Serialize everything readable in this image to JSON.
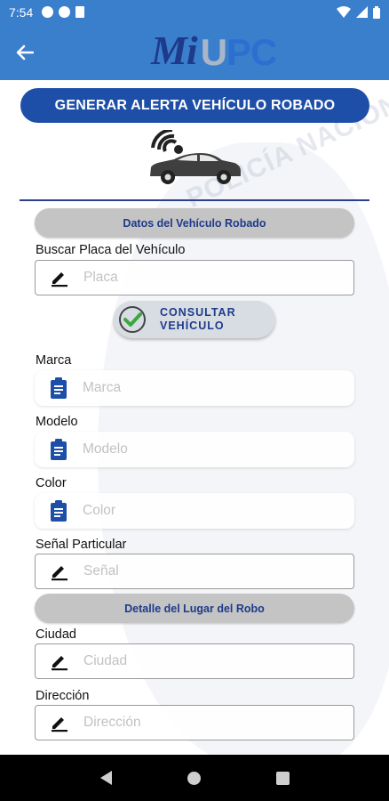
{
  "status_bar": {
    "time": "7:54"
  },
  "app_bar": {
    "logo_mi": "Mi",
    "logo_u": "U",
    "logo_pc": "PC"
  },
  "title_button": "GENERAR ALERTA VEHÍCULO ROBADO",
  "watermark": "POLICÍA NACIONAL",
  "sections": {
    "vehicle": "Datos del Vehículo Robado",
    "location": "Detalle del Lugar del Robo"
  },
  "fields": {
    "placa": {
      "label": "Buscar Placa del Vehículo",
      "placeholder": "Placa"
    },
    "marca": {
      "label": "Marca",
      "placeholder": "Marca"
    },
    "modelo": {
      "label": "Modelo",
      "placeholder": "Modelo"
    },
    "color": {
      "label": "Color",
      "placeholder": "Color"
    },
    "senal": {
      "label": "Señal Particular",
      "placeholder": "Señal"
    },
    "ciudad": {
      "label": "Ciudad",
      "placeholder": "Ciudad"
    },
    "direccion": {
      "label": "Dirección",
      "placeholder": "Dirección"
    }
  },
  "consult_button": {
    "line1": "CONSULTAR",
    "line2": "VEHÍCULO"
  },
  "colors": {
    "primary_bar": "#3a7fcc",
    "dark_blue": "#1e4fa8",
    "section_gray": "#c4c4c4"
  },
  "icons": {
    "back": "arrow-left-icon",
    "edit": "pencil-icon",
    "clipboard": "clipboard-icon",
    "check": "check-circle-icon",
    "car": "car-signal-icon"
  }
}
